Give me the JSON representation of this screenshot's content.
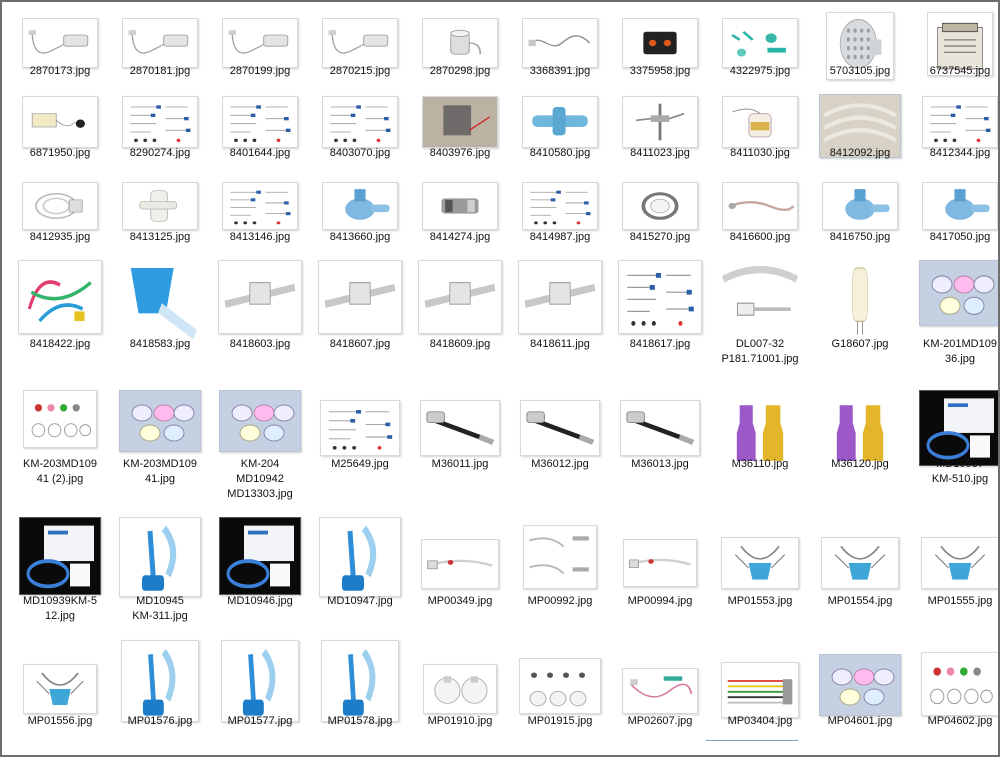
{
  "window": {
    "title": ""
  },
  "files": [
    {
      "name": "2870173.jpg",
      "icon": "cable-sensor"
    },
    {
      "name": "2870181.jpg",
      "icon": "cable-sensor"
    },
    {
      "name": "2870199.jpg",
      "icon": "cable-sensor"
    },
    {
      "name": "2870215.jpg",
      "icon": "cable-sensor"
    },
    {
      "name": "2870298.jpg",
      "icon": "cup-connector"
    },
    {
      "name": "3368391.jpg",
      "icon": "coiled-cable"
    },
    {
      "name": "3375958.jpg",
      "icon": "black-valve"
    },
    {
      "name": "4322975.jpg",
      "icon": "kit-parts"
    },
    {
      "name": "5703105.jpg",
      "icon": "filter-disc"
    },
    {
      "name": "6737545.jpg",
      "icon": "filter-box"
    },
    {
      "name": "6871950.jpg",
      "icon": "sensor-module"
    },
    {
      "name": "8290274.jpg",
      "icon": "parts-diagram"
    },
    {
      "name": "8401644.jpg",
      "icon": "parts-diagram"
    },
    {
      "name": "8403070.jpg",
      "icon": "parts-diagram"
    },
    {
      "name": "8403976.jpg",
      "icon": "photo-device"
    },
    {
      "name": "8410580.jpg",
      "icon": "blue-valve"
    },
    {
      "name": "8411023.jpg",
      "icon": "probe"
    },
    {
      "name": "8411030.jpg",
      "icon": "chamber"
    },
    {
      "name": "8412092.jpg",
      "icon": "tubing-photo"
    },
    {
      "name": "8412344.jpg",
      "icon": "parts-diagram"
    },
    {
      "name": "8412935.jpg",
      "icon": "tubing-coil"
    },
    {
      "name": "8413125.jpg",
      "icon": "white-connector"
    },
    {
      "name": "8413146.jpg",
      "icon": "parts-diagram"
    },
    {
      "name": "8413660.jpg",
      "icon": "blue-nebulizer"
    },
    {
      "name": "8414274.jpg",
      "icon": "metal-adapter"
    },
    {
      "name": "8414987.jpg",
      "icon": "parts-diagram"
    },
    {
      "name": "8415270.jpg",
      "icon": "ring-connector"
    },
    {
      "name": "8416600.jpg",
      "icon": "temp-probe"
    },
    {
      "name": "8416750.jpg",
      "icon": "blue-nebulizer"
    },
    {
      "name": "8417050.jpg",
      "icon": "blue-nebulizer"
    },
    {
      "name": "8418422.jpg",
      "icon": "colored-tubes"
    },
    {
      "name": "8418583.jpg",
      "icon": "blue-cup"
    },
    {
      "name": "8418603.jpg",
      "icon": "clip-bar"
    },
    {
      "name": "8418607.jpg",
      "icon": "clip-bar"
    },
    {
      "name": "8418609.jpg",
      "icon": "clip-bar"
    },
    {
      "name": "8418611.jpg",
      "icon": "clip-bar"
    },
    {
      "name": "8418617.jpg",
      "icon": "parts-diagram"
    },
    {
      "name": "DL007-32\nP181.71001.jpg",
      "icon": "gray-cable"
    },
    {
      "name": "G18607.jpg",
      "icon": "bulb"
    },
    {
      "name": "KM-201MD109\n36.jpg",
      "icon": "masks-photo"
    },
    {
      "name": "KM-203MD109\n41 (2).jpg",
      "icon": "mask-set"
    },
    {
      "name": "KM-203MD109\n41.jpg",
      "icon": "masks-photo"
    },
    {
      "name": "KM-204\nMD10942\nMD13303.jpg",
      "icon": "masks-photo"
    },
    {
      "name": "M25649.jpg",
      "icon": "parts-diagram"
    },
    {
      "name": "M36011.jpg",
      "icon": "hose"
    },
    {
      "name": "M36012.jpg",
      "icon": "hose"
    },
    {
      "name": "M36013.jpg",
      "icon": "hose"
    },
    {
      "name": "M36110.jpg",
      "icon": "caps-purple-yellow"
    },
    {
      "name": "M36120.jpg",
      "icon": "caps-purple-yellow"
    },
    {
      "name": "MD10937\nKM-510.jpg",
      "icon": "boxed-kit"
    },
    {
      "name": "MD10939KM-5\n12.jpg",
      "icon": "boxed-kit"
    },
    {
      "name": "MD10945\nKM-311.jpg",
      "icon": "blue-mask-kit"
    },
    {
      "name": "MD10946.jpg",
      "icon": "boxed-kit"
    },
    {
      "name": "MD10947.jpg",
      "icon": "blue-mask-kit"
    },
    {
      "name": "MP00349.jpg",
      "icon": "tube-line"
    },
    {
      "name": "MP00992.jpg",
      "icon": "tube-pair"
    },
    {
      "name": "MP00994.jpg",
      "icon": "tube-line"
    },
    {
      "name": "MP01553.jpg",
      "icon": "mask-strap"
    },
    {
      "name": "MP01554.jpg",
      "icon": "mask-strap"
    },
    {
      "name": "MP01555.jpg",
      "icon": "mask-strap"
    },
    {
      "name": "MP01556.jpg",
      "icon": "mask-strap"
    },
    {
      "name": "MP01576.jpg",
      "icon": "blue-mask-kit"
    },
    {
      "name": "MP01577.jpg",
      "icon": "blue-mask-kit"
    },
    {
      "name": "MP01578.jpg",
      "icon": "blue-mask-kit"
    },
    {
      "name": "MP01910.jpg",
      "icon": "cups-pair"
    },
    {
      "name": "MP01915.jpg",
      "icon": "cups-set"
    },
    {
      "name": "MP02607.jpg",
      "icon": "tube-curl"
    },
    {
      "name": "MP03404.jpg",
      "icon": "color-cables"
    },
    {
      "name": "MP04601.jpg",
      "icon": "masks-photo"
    },
    {
      "name": "MP04602.jpg",
      "icon": "mask-set"
    }
  ]
}
